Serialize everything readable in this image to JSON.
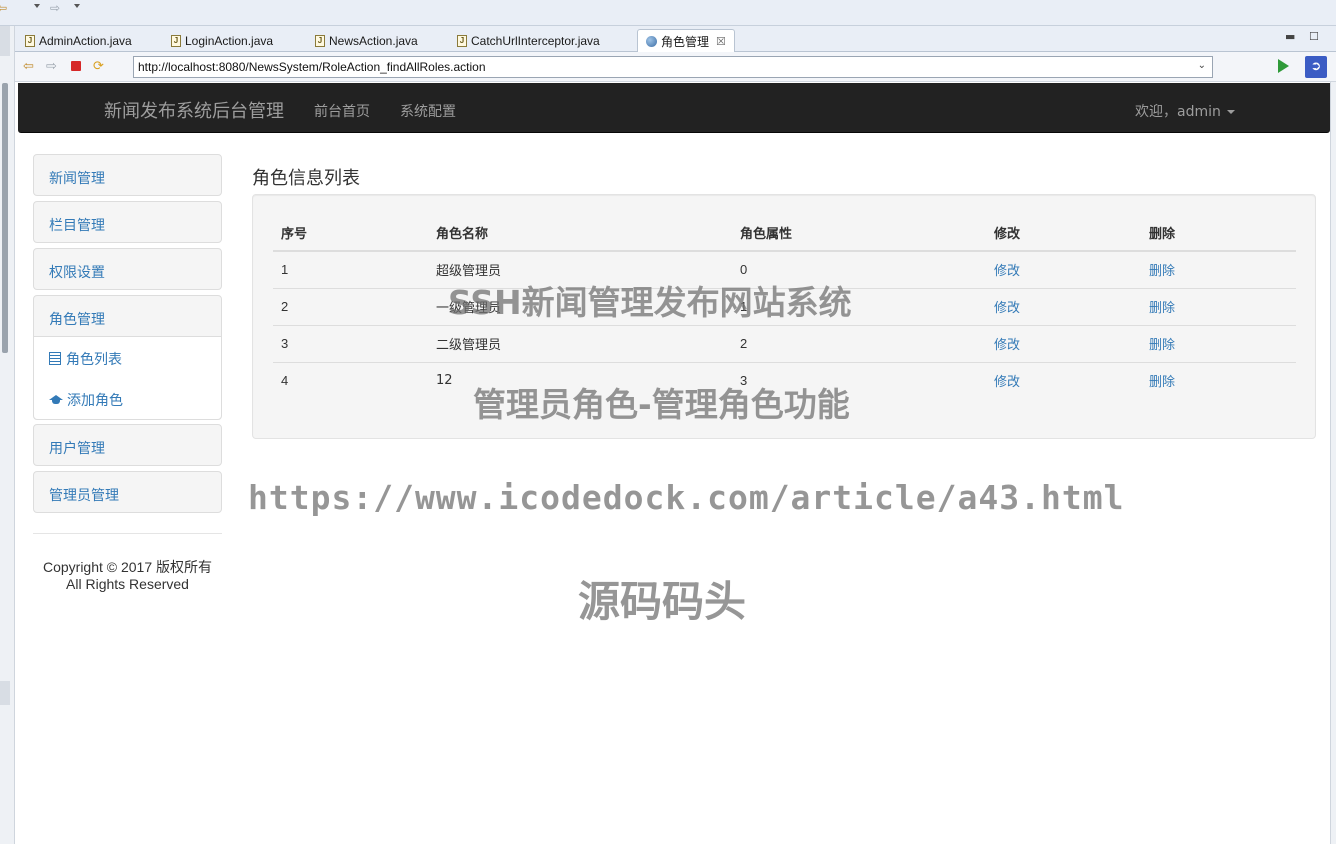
{
  "ide": {
    "tabs": [
      {
        "label": "AdminAction.java"
      },
      {
        "label": "LoginAction.java"
      },
      {
        "label": "NewsAction.java"
      },
      {
        "label": "CatchUrlInterceptor.java"
      },
      {
        "label": "角色管理"
      }
    ],
    "url": "http://localhost:8080/NewsSystem/RoleAction_findAllRoles.action"
  },
  "navbar": {
    "brand": "新闻发布系统后台管理",
    "links": [
      "前台首页",
      "系统配置"
    ],
    "user": "欢迎，admin"
  },
  "sidebar": {
    "panels": [
      {
        "label": "新闻管理"
      },
      {
        "label": "栏目管理"
      },
      {
        "label": "权限设置"
      },
      {
        "label": "角色管理",
        "sub": [
          "角色列表",
          "添加角色"
        ]
      },
      {
        "label": "用户管理"
      },
      {
        "label": "管理员管理"
      }
    ],
    "copyright_line1": "Copyright © 2017 版权所有",
    "copyright_line2": "All Rights Reserved"
  },
  "main": {
    "title": "角色信息列表",
    "headers": [
      "序号",
      "角色名称",
      "角色属性",
      "修改",
      "删除"
    ],
    "rows": [
      {
        "id": "1",
        "name": "超级管理员",
        "attr": "0",
        "edit": "修改",
        "del": "删除"
      },
      {
        "id": "2",
        "name": "一级管理员",
        "attr": "1",
        "edit": "修改",
        "del": "删除"
      },
      {
        "id": "3",
        "name": "二级管理员",
        "attr": "2",
        "edit": "修改",
        "del": "删除"
      },
      {
        "id": "4",
        "name": "12",
        "attr": "3",
        "edit": "修改",
        "del": "删除"
      }
    ]
  },
  "watermark": {
    "line1": "SSH新闻管理发布网站系统",
    "line2": "管理员角色-管理角色功能",
    "line3": "https://www.icodedock.com/article/a43.html",
    "line4": "源码码头"
  },
  "colors": {
    "navbar_bg": "#222222",
    "link": "#337ab7",
    "panel_bg": "#f5f5f5",
    "text": "#333333"
  }
}
